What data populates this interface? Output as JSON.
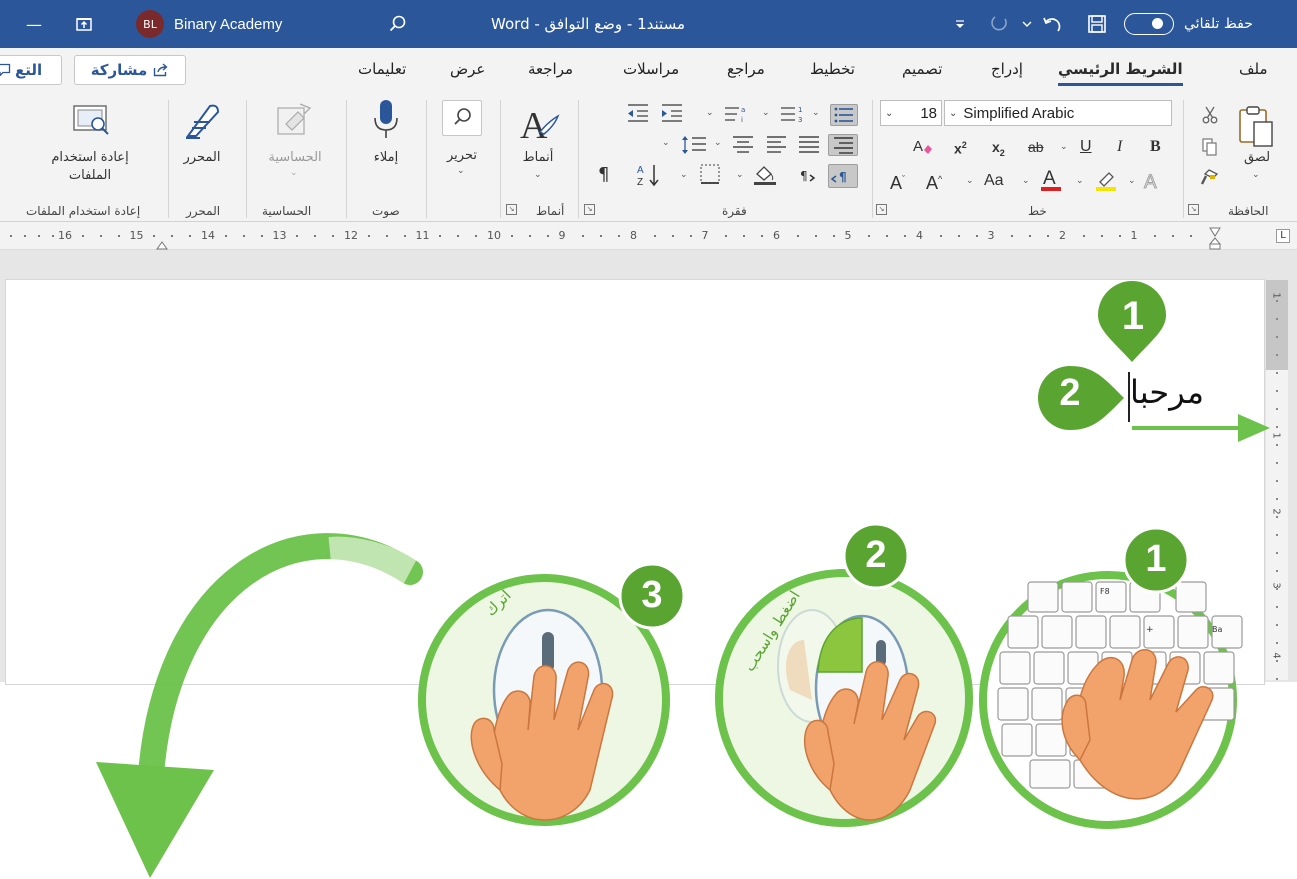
{
  "titlebar": {
    "account_initials": "BL",
    "account_name": "Binary Academy",
    "doc_title": "مستند1 - وضع التوافق - Word",
    "autosave_label": "حفظ تلقائي"
  },
  "tabs": [
    "ملف",
    "الشريط الرئيسي",
    "إدراج",
    "تصميم",
    "تخطيط",
    "مراجع",
    "مراسلات",
    "مراجعة",
    "عرض",
    "تعليمات"
  ],
  "share_label": "مشاركة",
  "comments_label": "التع",
  "ribbon": {
    "clipboard": {
      "paste_label": "لصق",
      "group_label": "الحافظة"
    },
    "font": {
      "font_name": "Simplified Arabic",
      "font_size": "18",
      "change_case_label": "Aa",
      "group_label": "خط"
    },
    "paragraph": {
      "group_label": "فقرة"
    },
    "styles": {
      "styles_label": "أنماط",
      "group_label": "أنماط"
    },
    "editing": {
      "editing_label": "تحرير"
    },
    "voice": {
      "dictate_label": "إملاء",
      "group_label": "صوت"
    },
    "sensitivity": {
      "label": "الحساسية",
      "group_label": "الحساسية"
    },
    "editor": {
      "label": "المحرر",
      "group_label": "المحرر"
    },
    "reuse": {
      "label_line1": "إعادة استخدام",
      "label_line2": "الملفات",
      "group_label": "إعادة استخدام الملفات"
    }
  },
  "ruler_numbers": [
    "16",
    "15",
    "14",
    "13",
    "12",
    "11",
    "10",
    "9",
    "8",
    "7",
    "6",
    "5",
    "4",
    "3",
    "2",
    "1"
  ],
  "vruler_numbers": [
    "1",
    "1",
    "2",
    "3",
    "4"
  ],
  "document": {
    "text": "مرحبا"
  },
  "annotations": {
    "marker_doc_1": "1",
    "marker_doc_2": "2",
    "step1_number": "1",
    "step2_number": "2",
    "step2_caption": "اضغط واسحب",
    "step3_number": "3",
    "step3_caption": "اترك"
  },
  "colors": {
    "titlebar": "#2b579a",
    "accent_green": "#6cc24a",
    "marker_green": "#5aa532",
    "skin": "#f2a36b",
    "font_color_underline": "#e02020",
    "highlight_underline": "#f5e600"
  },
  "icons": [
    "minimize-icon",
    "restore-icon",
    "search-icon",
    "redo-icon",
    "undo-icon",
    "save-icon",
    "share-icon",
    "comment-icon",
    "paste-icon",
    "cut-icon",
    "copy-icon",
    "format-painter-icon",
    "microphone-icon",
    "find-icon",
    "styles-icon",
    "editor-pen-icon",
    "sensitivity-icon",
    "reuse-files-icon"
  ]
}
